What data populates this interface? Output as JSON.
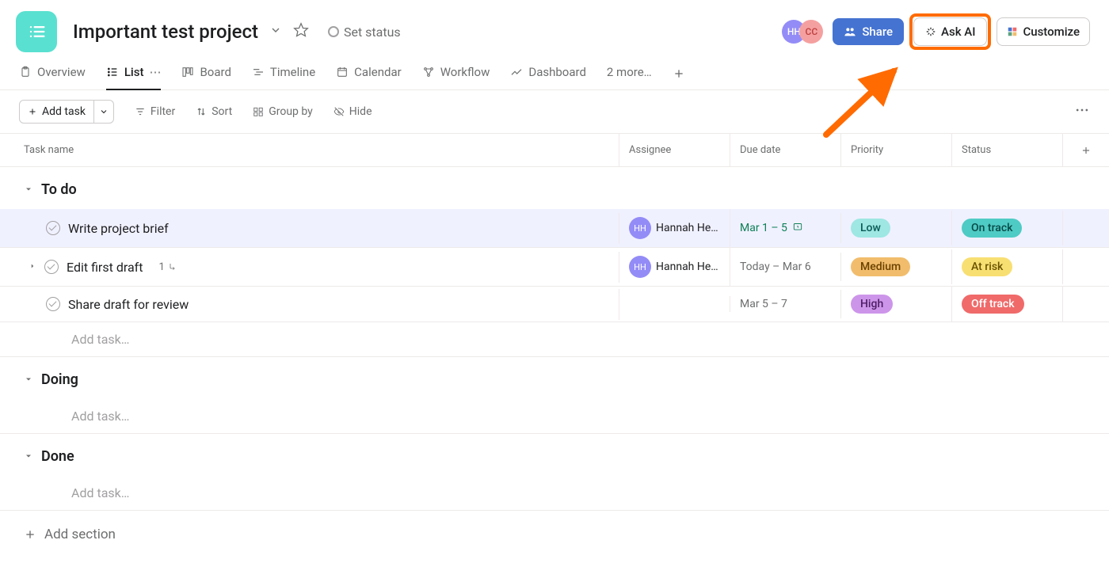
{
  "header": {
    "project_title": "Important test project",
    "set_status_label": "Set status",
    "share_label": "Share",
    "ask_ai_label": "Ask AI",
    "customize_label": "Customize",
    "avatars": [
      {
        "initials": "HH",
        "class": "hannah"
      },
      {
        "initials": "CC",
        "class": "cc"
      }
    ]
  },
  "tabs": {
    "items": [
      {
        "label": "Overview",
        "icon": "clipboard"
      },
      {
        "label": "List",
        "icon": "list",
        "active": true
      },
      {
        "label": "Board",
        "icon": "board"
      },
      {
        "label": "Timeline",
        "icon": "timeline"
      },
      {
        "label": "Calendar",
        "icon": "calendar"
      },
      {
        "label": "Workflow",
        "icon": "workflow"
      },
      {
        "label": "Dashboard",
        "icon": "dashboard"
      }
    ],
    "more_label": "2 more…"
  },
  "toolbar": {
    "add_task_label": "Add task",
    "filter_label": "Filter",
    "sort_label": "Sort",
    "group_by_label": "Group by",
    "hide_label": "Hide"
  },
  "columns": {
    "task_name": "Task name",
    "assignee": "Assignee",
    "due_date": "Due date",
    "priority": "Priority",
    "status": "Status"
  },
  "sections": [
    {
      "name": "To do",
      "tasks": [
        {
          "name": "Write project brief",
          "assignee": {
            "initials": "HH",
            "name": "Hannah Her…"
          },
          "due": "Mar 1 – 5",
          "due_style": "green",
          "recurring": true,
          "priority": {
            "label": "Low",
            "class": "low"
          },
          "status": {
            "label": "On track",
            "class": "ontrack"
          },
          "highlighted": true
        },
        {
          "name": "Edit first draft",
          "assignee": {
            "initials": "HH",
            "name": "Hannah Her…"
          },
          "due": "Today – Mar 6",
          "due_style": "gray",
          "subtasks": "1",
          "expandable": true,
          "priority": {
            "label": "Medium",
            "class": "medium"
          },
          "status": {
            "label": "At risk",
            "class": "atrisk"
          }
        },
        {
          "name": "Share draft for review",
          "due": "Mar 5 – 7",
          "due_style": "gray",
          "priority": {
            "label": "High",
            "class": "high"
          },
          "status": {
            "label": "Off track",
            "class": "offtrack"
          }
        }
      ],
      "add_task": "Add task…"
    },
    {
      "name": "Doing",
      "tasks": [],
      "add_task": "Add task…"
    },
    {
      "name": "Done",
      "tasks": [],
      "add_task": "Add task…"
    }
  ],
  "add_section_label": "Add section"
}
